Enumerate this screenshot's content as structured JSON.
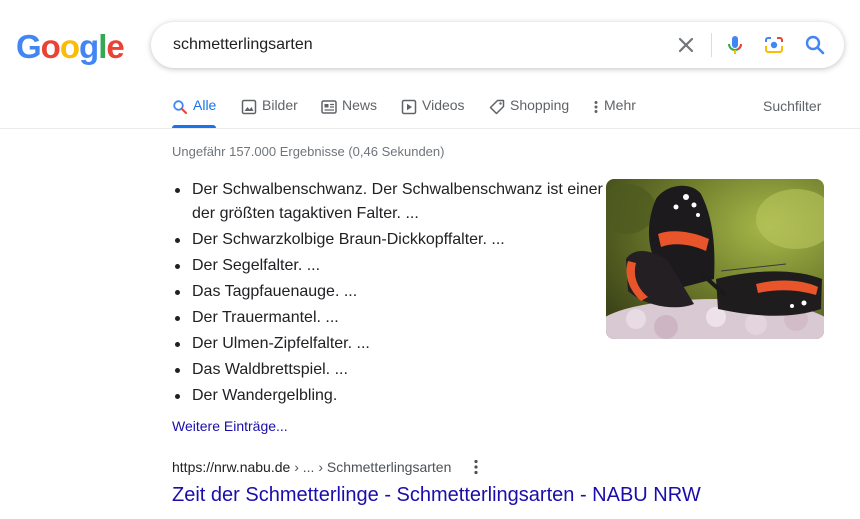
{
  "logo": [
    "G",
    "o",
    "o",
    "g",
    "l",
    "e"
  ],
  "search": {
    "query": "schmetterlingsarten"
  },
  "tabs": [
    {
      "label": "Alle",
      "icon": "search-icon"
    },
    {
      "label": "Bilder",
      "icon": "image-icon"
    },
    {
      "label": "News",
      "icon": "news-icon"
    },
    {
      "label": "Videos",
      "icon": "video-icon"
    },
    {
      "label": "Shopping",
      "icon": "tag-icon"
    },
    {
      "label": "Mehr",
      "icon": "more-vert-icon"
    }
  ],
  "searchfilter": "Suchfilter",
  "stats": "Ungefähr 157.000 Ergebnisse (0,46 Sekunden)",
  "snippet": {
    "items": [
      "Der Schwalbenschwanz. Der Schwalbenschwanz ist einer der größten tagaktiven Falter. ...",
      "Der Schwarzkolbige Braun-Dickkopffalter. ...",
      "Der Segelfalter. ...",
      "Das Tagpfauenauge. ...",
      "Der Trauermantel. ...",
      "Der Ulmen-Zipfelfalter. ...",
      "Das Waldbrettspiel. ...",
      "Der Wandergelbling."
    ],
    "more": "Weitere Einträge..."
  },
  "result": {
    "domain": "https://nrw.nabu.de",
    "path": " › ... › Schmetterlingsarten",
    "title": "Zeit der Schmetterlinge - Schmetterlingsarten - NABU NRW"
  },
  "colors": {
    "link": "#1a0dab",
    "accent": "#1a73e8",
    "logo": [
      "#4285f4",
      "#ea4335",
      "#fbbc05",
      "#4285f4",
      "#34a853",
      "#ea4335"
    ]
  }
}
